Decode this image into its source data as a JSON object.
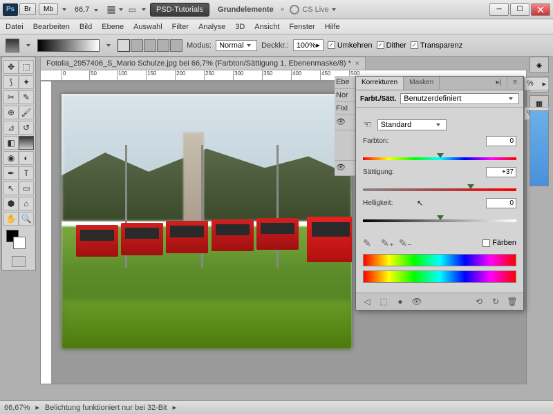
{
  "titlebar": {
    "app_icon": "Ps",
    "btn_br": "Br",
    "btn_mb": "Mb",
    "zoom": "66,7",
    "dark1": "PSD-Tutorials",
    "dark2": "Grundelemente",
    "cslive": "CS Live"
  },
  "menu": [
    "Datei",
    "Bearbeiten",
    "Bild",
    "Ebene",
    "Auswahl",
    "Filter",
    "Analyse",
    "3D",
    "Ansicht",
    "Fenster",
    "Hilfe"
  ],
  "optbar": {
    "mode_label": "Modus:",
    "mode_value": "Normal",
    "opacity_label": "Deckkr.:",
    "opacity_value": "100%",
    "reverse": "Umkehren",
    "dither": "Dither",
    "transp": "Transparenz"
  },
  "doc_tab": "Fotolia_2957406_S_Mario Schulze.jpg bei 66,7%  (Farbton/Sättigung 1, Ebenenmaske/8) *",
  "ruler_ticks": [
    "0",
    "50",
    "100",
    "150",
    "200",
    "250",
    "300",
    "350",
    "400",
    "450",
    "500"
  ],
  "behind": {
    "ebe": "Ebe",
    "nor": "Nor",
    "fix": "Fixi"
  },
  "pct": "%",
  "panel": {
    "tab_korr": "Korrekturen",
    "tab_mask": "Masken",
    "title": "Farbt./Sätt.",
    "preset": "Benutzerdefiniert",
    "channel": "Standard",
    "hue_label": "Farbton:",
    "hue_value": "0",
    "sat_label": "Sättigung:",
    "sat_value": "+37",
    "light_label": "Helligkeit:",
    "light_value": "0",
    "colorize": "Färben"
  },
  "status": {
    "zoom": "66,67%",
    "msg": "Belichtung funktioniert nur bei 32-Bit"
  }
}
